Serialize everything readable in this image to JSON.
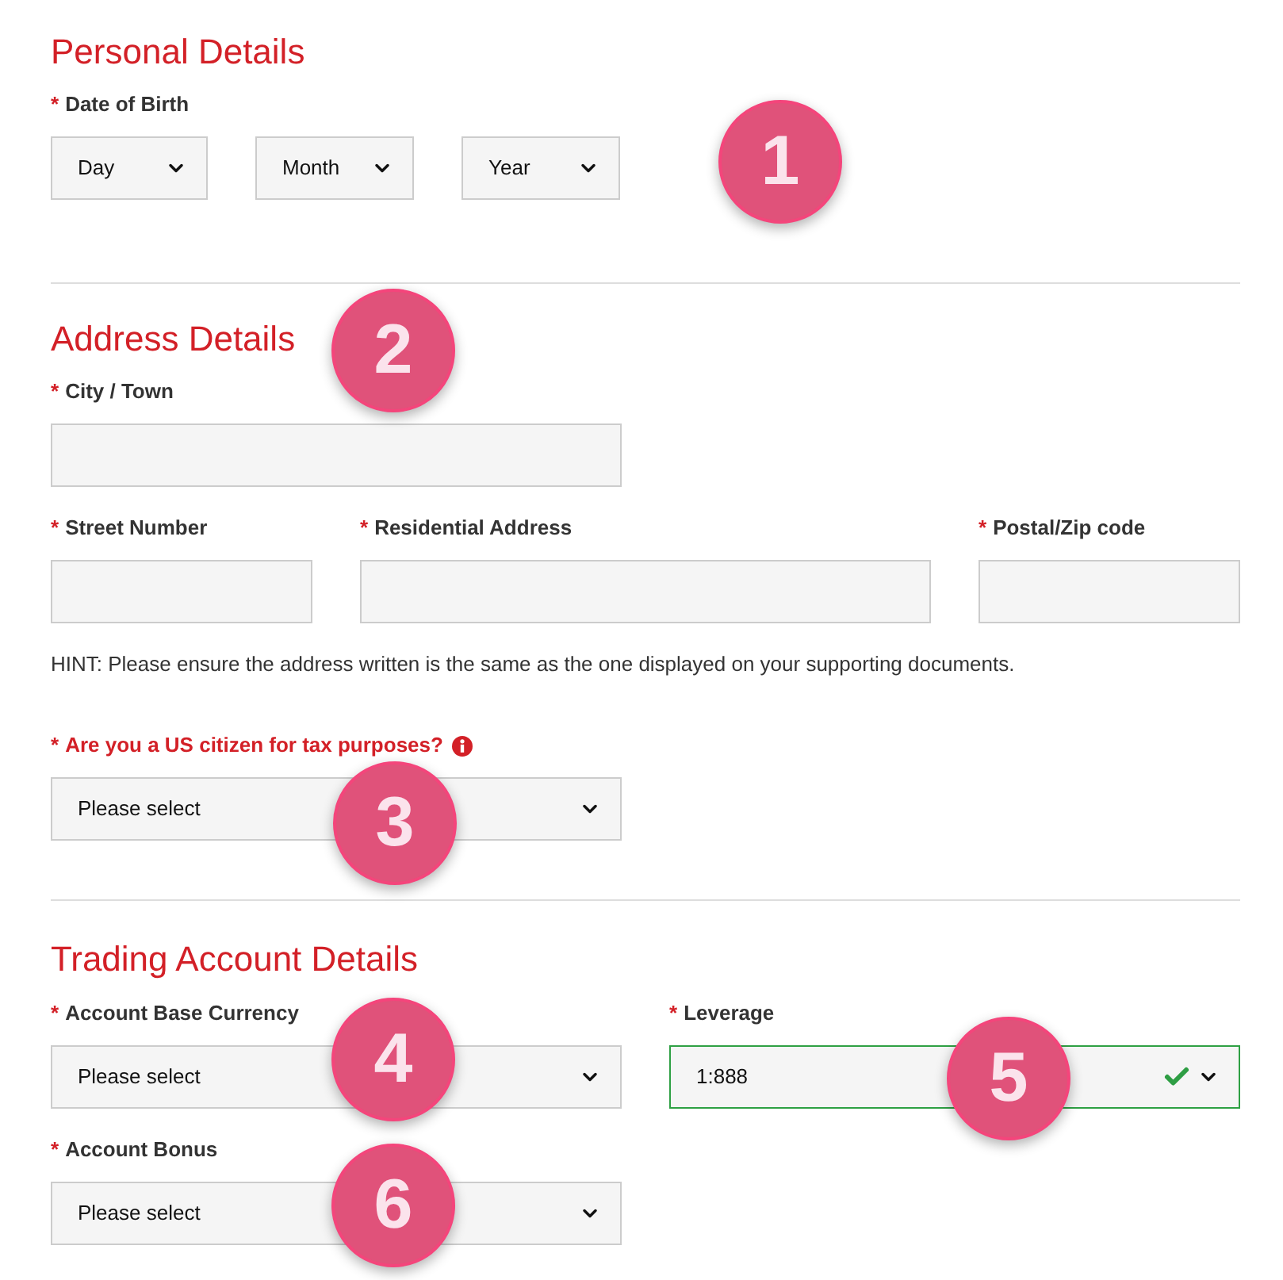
{
  "personal": {
    "title": "Personal Details",
    "dob": {
      "marker": "*",
      "label": "Date of Birth",
      "selects": [
        "Day",
        "Month",
        "Year"
      ]
    }
  },
  "address": {
    "title": "Address Details",
    "city": {
      "marker": "*",
      "label": "City / Town"
    },
    "row": [
      {
        "marker": "*",
        "label": "Street Number"
      },
      {
        "marker": "*",
        "label": "Residential Address"
      },
      {
        "marker": "*",
        "label": "Postal/Zip code"
      }
    ],
    "hint": "HINT: Please ensure the address written is the same as the one displayed on your supporting documents.",
    "us_citizen": {
      "marker": "*",
      "label": "Are you a US citizen for tax purposes?",
      "info": true,
      "value": "Please select"
    }
  },
  "trading": {
    "title": "Trading Account Details",
    "fields": [
      {
        "marker": "*",
        "label": "Account Base Currency",
        "value": "Please select",
        "valid": false
      },
      {
        "marker": "*",
        "label": "Leverage",
        "value": "1:888",
        "valid": true
      },
      {
        "marker": "*",
        "label": "Account Bonus",
        "value": "Please select",
        "valid": false
      }
    ]
  },
  "callouts": [
    "1",
    "2",
    "3",
    "4",
    "5",
    "6"
  ]
}
